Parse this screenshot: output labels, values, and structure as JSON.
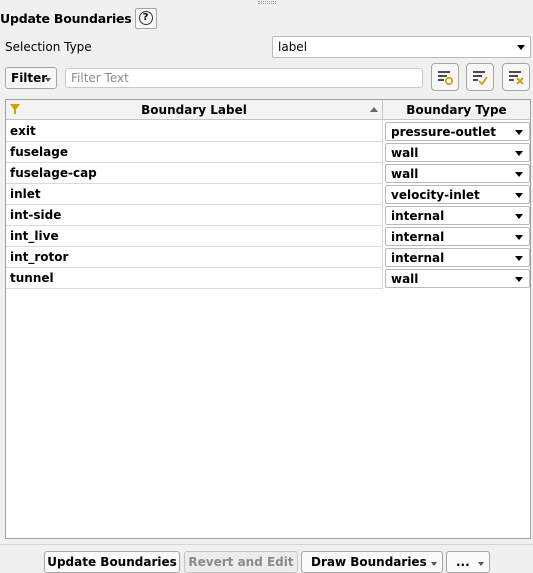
{
  "panel": {
    "title": "Update Boundaries",
    "help_icon": "question-circle-icon"
  },
  "selection": {
    "label": "Selection Type",
    "value": "label"
  },
  "filter": {
    "button_label": "Filter",
    "placeholder": "Filter Text",
    "value": "",
    "icons": [
      "filter-options-icon",
      "filter-select-all-icon",
      "filter-clear-icon"
    ]
  },
  "table": {
    "columns": [
      "Boundary Label",
      "Boundary Type"
    ],
    "rows": [
      {
        "label": "exit",
        "type": "pressure-outlet"
      },
      {
        "label": "fuselage",
        "type": "wall"
      },
      {
        "label": "fuselage-cap",
        "type": "wall"
      },
      {
        "label": "inlet",
        "type": "velocity-inlet"
      },
      {
        "label": "int-side",
        "type": "internal"
      },
      {
        "label": "int_live",
        "type": "internal"
      },
      {
        "label": "int_rotor",
        "type": "internal"
      },
      {
        "label": "tunnel",
        "type": "wall"
      }
    ]
  },
  "footer": {
    "update": "Update Boundaries",
    "revert": "Revert and Edit",
    "draw": "Draw Boundaries",
    "more": "..."
  }
}
